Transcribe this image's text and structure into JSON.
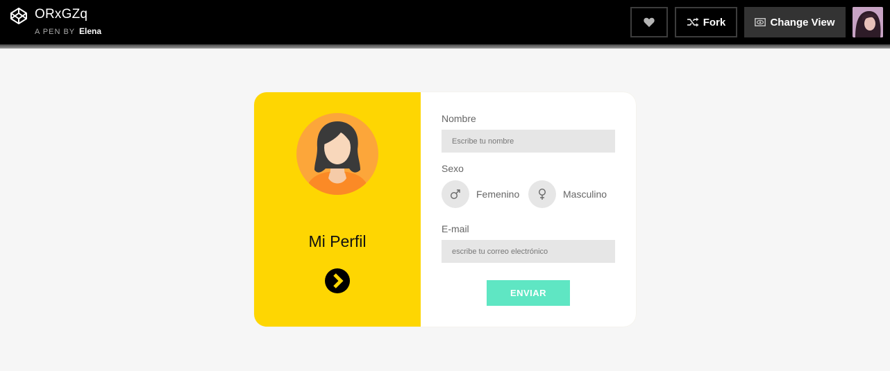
{
  "header": {
    "pen_title": "ORxGZq",
    "byline_prefix": "A PEN BY",
    "author": "Elena",
    "fork_label": "Fork",
    "change_view_label": "Change View"
  },
  "card": {
    "title": "Mi Perfil",
    "colors": {
      "left_panel": "#fed602",
      "avatar_bg": "#fca63a",
      "submit": "#5fe6c3"
    }
  },
  "form": {
    "name_label": "Nombre",
    "name_placeholder": "Escribe tu nombre",
    "sex_label": "Sexo",
    "option_1": "Femenino",
    "option_2": "Masculino",
    "email_label": "E-mail",
    "email_placeholder": "escribe tu correo electrónico",
    "submit_label": "ENVIAR"
  },
  "icons": [
    "codepen-logo-icon",
    "heart-icon",
    "fork-icon",
    "eye-icon",
    "male-icon",
    "female-icon",
    "chevron-right-icon"
  ]
}
